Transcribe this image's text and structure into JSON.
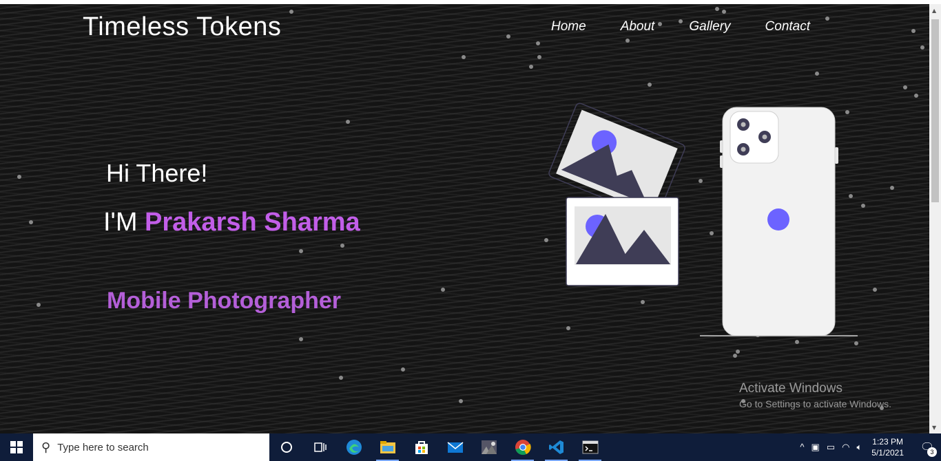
{
  "brand": "Timeless Tokens",
  "nav": [
    {
      "label": "Home"
    },
    {
      "label": "About"
    },
    {
      "label": "Gallery"
    },
    {
      "label": "Contact"
    }
  ],
  "hero": {
    "greeting": "Hi There!",
    "prefix": "I'M",
    "name": "Prakarsh Sharma",
    "role": "Mobile Photographer"
  },
  "watermark": {
    "title": "Activate Windows",
    "subtitle": "Go to Settings to activate Windows."
  },
  "taskbar": {
    "search_placeholder": "Type here to search",
    "apps": [
      "cortana-icon",
      "task-view-icon",
      "edge-icon",
      "file-explorer-icon",
      "store-icon",
      "mail-icon",
      "photos-icon",
      "chrome-icon",
      "vscode-icon",
      "terminal-icon"
    ],
    "time": "1:23 PM",
    "date": "5/1/2021",
    "notification_count": "3"
  },
  "colors": {
    "accent_purple": "#c25ee8",
    "illustration_purple": "#6c63ff",
    "illustration_dark": "#3f3d56",
    "background": "#141414"
  }
}
